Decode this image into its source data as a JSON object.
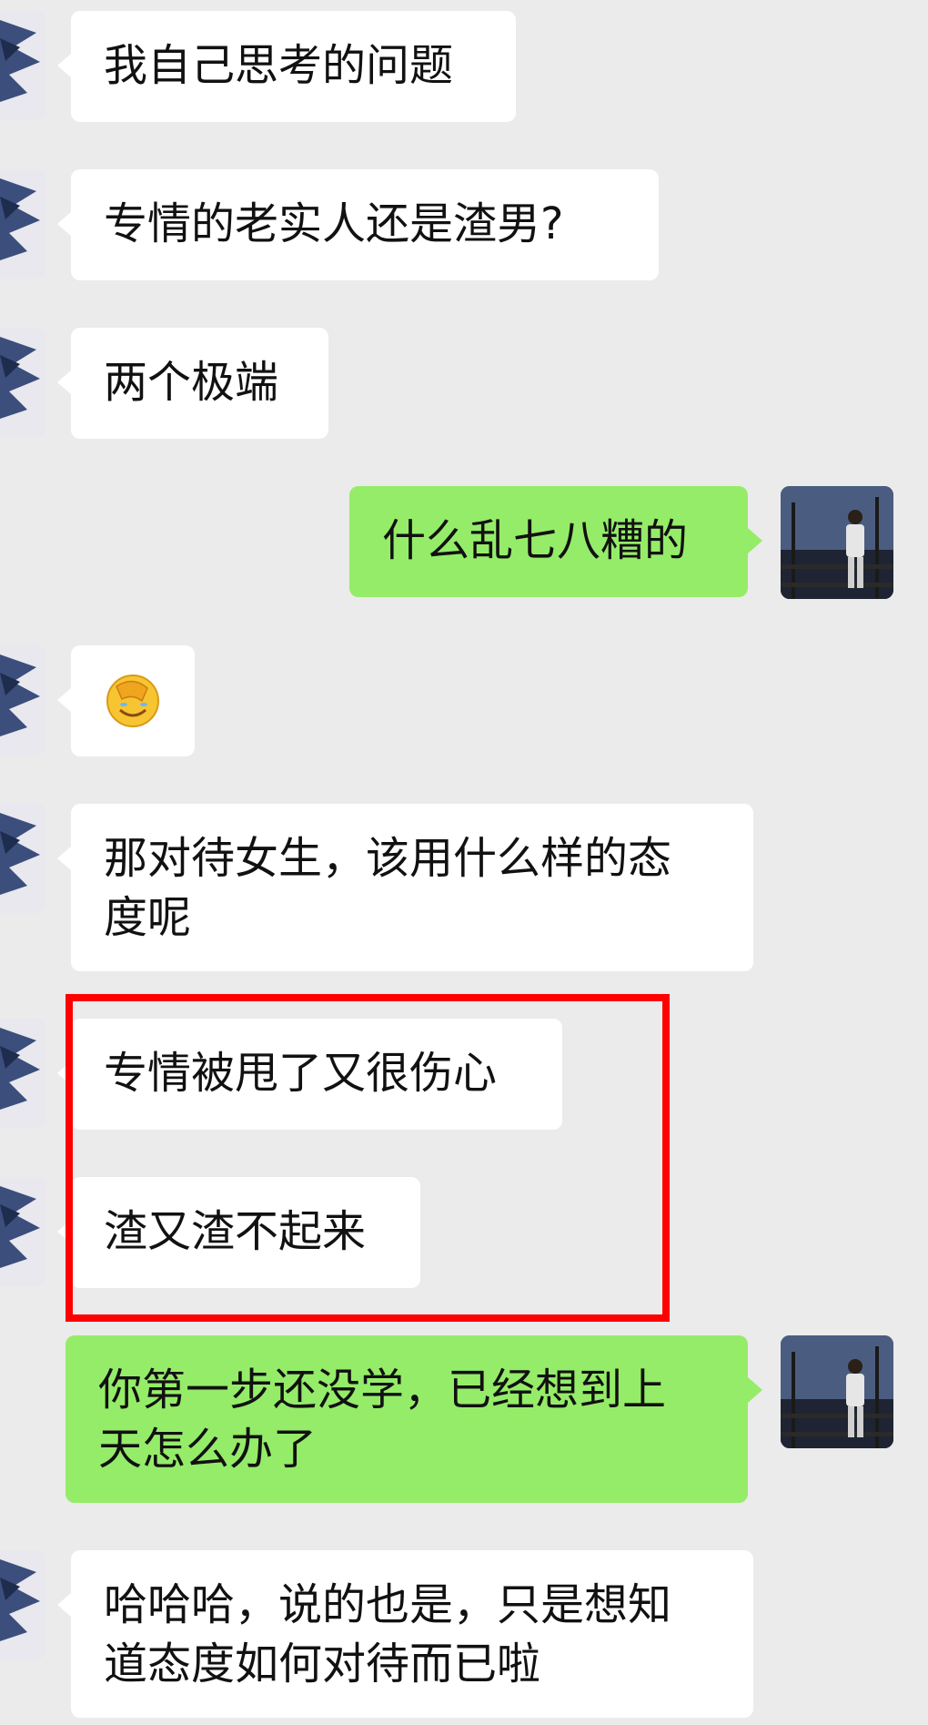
{
  "colors": {
    "background": "#ebebeb",
    "incoming_bubble": "#ffffff",
    "outgoing_bubble": "#95ec69",
    "highlight": "#ff0000"
  },
  "messages": [
    {
      "sender": "other",
      "text": "我自己思考的问题"
    },
    {
      "sender": "other",
      "text": "专情的老实人还是渣男?"
    },
    {
      "sender": "other",
      "text": "两个极端"
    },
    {
      "sender": "me",
      "text": "什么乱七八糟的"
    },
    {
      "sender": "other",
      "emoji": "facepalm-emoji"
    },
    {
      "sender": "other",
      "text": "那对待女生，该用什么样的态\n度呢"
    },
    {
      "sender": "other",
      "text": "专情被甩了又很伤心",
      "highlighted": true
    },
    {
      "sender": "other",
      "text": "渣又渣不起来",
      "highlighted": true
    },
    {
      "sender": "me",
      "text": "你第一步还没学，已经想到上\n天怎么办了"
    },
    {
      "sender": "other",
      "text": "哈哈哈，说的也是，只是想知\n道态度如何对待而已啦"
    }
  ]
}
